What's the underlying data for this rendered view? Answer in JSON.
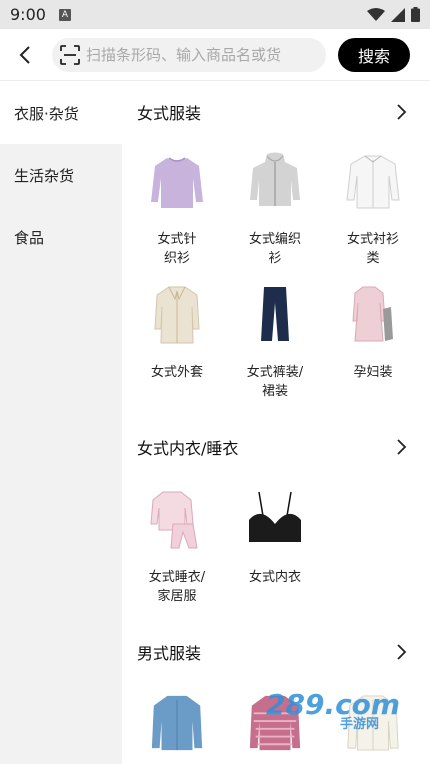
{
  "status": {
    "time": "9:00",
    "notification_badge": "A"
  },
  "search": {
    "placeholder": "扫描条形码、输入商品名或货",
    "button_label": "搜索"
  },
  "sidebar": {
    "items": [
      {
        "label": "衣服·杂货"
      },
      {
        "label": "生活杂货"
      },
      {
        "label": "食品"
      }
    ]
  },
  "sections": [
    {
      "title": "女式服装",
      "items": [
        {
          "label": "女式针织衫",
          "icon": "lilac-knit-sweater"
        },
        {
          "label": "女式编织衫",
          "icon": "grey-hooded-cardigan"
        },
        {
          "label": "女式衬衫类",
          "icon": "white-blouse"
        },
        {
          "label": "女式外套",
          "icon": "beige-long-coat"
        },
        {
          "label": "女式裤装/裙装",
          "icon": "navy-wide-trousers"
        },
        {
          "label": "孕妇装",
          "icon": "pink-maternity-dress"
        }
      ]
    },
    {
      "title": "女式内衣/睡衣",
      "items": [
        {
          "label": "女式睡衣/家居服",
          "icon": "pink-check-pajamas"
        },
        {
          "label": "女式内衣",
          "icon": "black-lace-bra"
        }
      ]
    },
    {
      "title": "男式服装",
      "items": [
        {
          "label": "",
          "icon": "blue-denim-shirt"
        },
        {
          "label": "",
          "icon": "pink-striped-shirt"
        },
        {
          "label": "",
          "icon": "white-shirt"
        }
      ]
    }
  ],
  "watermark": {
    "text": "289.com",
    "subtext": "手游网"
  },
  "colors": {
    "accent": "#000000",
    "sidebar_bg": "#f2f2f2",
    "status_bar_bg": "#e7e7e7"
  }
}
